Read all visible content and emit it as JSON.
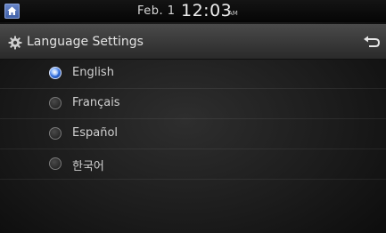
{
  "status_bar": {
    "date": "Feb.  1",
    "time": "12:03",
    "ampm": "AM"
  },
  "header": {
    "title": "Language Settings"
  },
  "languages": [
    {
      "label": "English",
      "selected": true
    },
    {
      "label": "Français",
      "selected": false
    },
    {
      "label": "Español",
      "selected": false
    },
    {
      "label": "한국어",
      "selected": false
    }
  ],
  "colors": {
    "accent": "#3d5ea6",
    "selected_radio": "#2f6ad8"
  },
  "icons": {
    "home": "home-icon",
    "settings": "gear-icon",
    "back": "back-arrow-icon"
  }
}
